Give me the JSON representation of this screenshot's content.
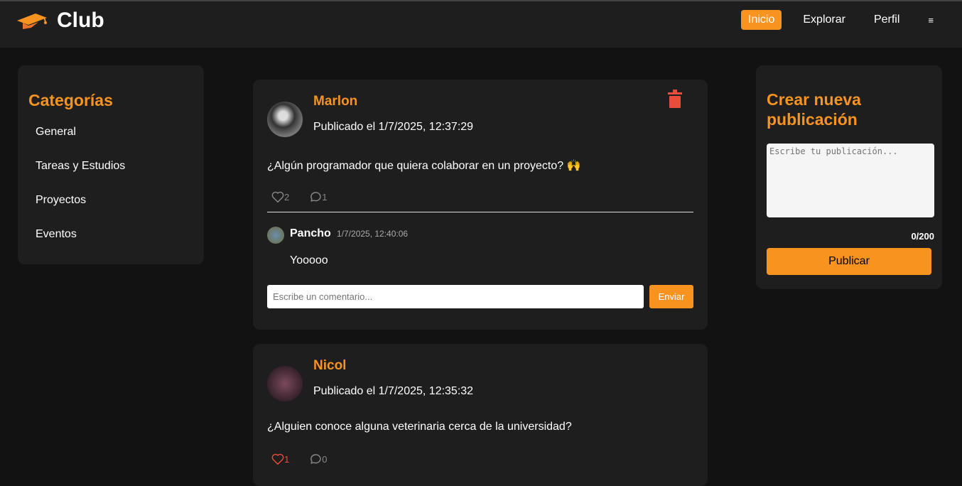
{
  "header": {
    "title": "Club",
    "nav": [
      "Inicio",
      "Explorar",
      "Perfil"
    ],
    "menu_icon": "≡"
  },
  "sidebar": {
    "title": "Categorías",
    "items": [
      "General",
      "Tareas y Estudios",
      "Proyectos",
      "Eventos"
    ]
  },
  "posts": [
    {
      "author": "Marlon",
      "date": "Publicado el 1/7/2025, 12:37:29",
      "text": "¿Algún programador que quiera colaborar en un proyecto? 🙌",
      "likes": "2",
      "comments": "1",
      "comment": {
        "author": "Pancho",
        "date": "1/7/2025, 12:40:06",
        "text": "Yooooo"
      },
      "comment_placeholder": "Escribe un comentario...",
      "send": "Enviar"
    },
    {
      "author": "Nicol",
      "date": "Publicado el 1/7/2025, 12:35:32",
      "text": "¿Alguien conoce alguna veterinaria cerca de la universidad?",
      "likes": "1",
      "comments": "0"
    }
  ],
  "create": {
    "title": "Crear nueva publicación",
    "placeholder": "Escribe tu publicación...",
    "counter": "0/200",
    "button": "Publicar"
  },
  "colors": {
    "accent": "#f7931e",
    "delete": "#e74c3c",
    "liked": "#e74c3c"
  }
}
